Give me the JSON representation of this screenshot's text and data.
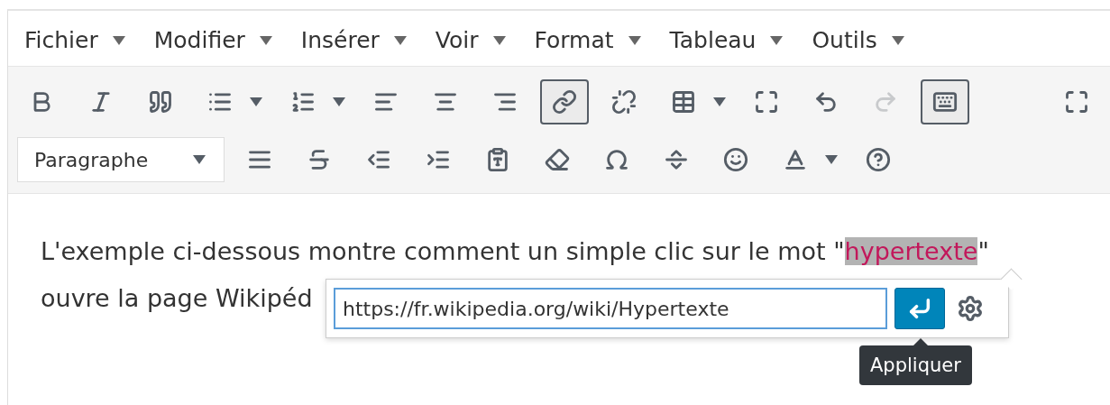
{
  "menu": [
    {
      "label": "Fichier"
    },
    {
      "label": "Modifier"
    },
    {
      "label": "Insérer"
    },
    {
      "label": "Voir"
    },
    {
      "label": "Format"
    },
    {
      "label": "Tableau"
    },
    {
      "label": "Outils"
    }
  ],
  "toolbar_rows": [
    {
      "items": [
        {
          "kind": "button",
          "active": false,
          "disabled": false
        },
        {
          "kind": "button",
          "active": false,
          "disabled": false
        },
        {
          "kind": "button",
          "active": false,
          "disabled": false
        },
        {
          "kind": "split",
          "active": false,
          "disabled": false
        },
        {
          "kind": "split",
          "active": false,
          "disabled": false
        },
        {
          "kind": "button",
          "active": false,
          "disabled": false
        },
        {
          "kind": "button",
          "active": false,
          "disabled": false
        },
        {
          "kind": "button",
          "active": false,
          "disabled": false
        },
        {
          "kind": "button",
          "active": true,
          "disabled": false
        },
        {
          "kind": "button",
          "active": false,
          "disabled": false
        },
        {
          "kind": "split",
          "active": false,
          "disabled": false
        },
        {
          "kind": "button",
          "active": false,
          "disabled": false
        },
        {
          "kind": "button",
          "active": false,
          "disabled": false
        },
        {
          "kind": "button",
          "active": false,
          "disabled": true
        },
        {
          "kind": "button",
          "active": true,
          "disabled": false
        },
        {
          "kind": "button",
          "active": false,
          "disabled": false
        }
      ]
    },
    {
      "items": [
        {
          "kind": "select",
          "value": "Paragraphe"
        },
        {
          "kind": "button",
          "active": false,
          "disabled": false
        },
        {
          "kind": "button",
          "active": false,
          "disabled": false
        },
        {
          "kind": "button",
          "active": false,
          "disabled": false
        },
        {
          "kind": "button",
          "active": false,
          "disabled": false
        },
        {
          "kind": "button",
          "active": false,
          "disabled": false
        },
        {
          "kind": "button",
          "active": false,
          "disabled": false
        },
        {
          "kind": "button",
          "active": false,
          "disabled": false
        },
        {
          "kind": "button",
          "active": false,
          "disabled": false
        },
        {
          "kind": "button",
          "active": false,
          "disabled": false
        },
        {
          "kind": "split",
          "active": false,
          "disabled": false
        },
        {
          "kind": "button",
          "active": false,
          "disabled": false
        }
      ]
    }
  ],
  "content": {
    "line_1": {
      "before": "L'exemple ci-dessous montre comment un simple clic sur le mot \"",
      "link": "hypertexte",
      "after": "\""
    },
    "line_2": "ouvre la page Wikipéd"
  },
  "link_popup": {
    "url": "https://fr.wikipedia.org/wiki/Hypertexte",
    "tooltip": "Appliquer"
  }
}
